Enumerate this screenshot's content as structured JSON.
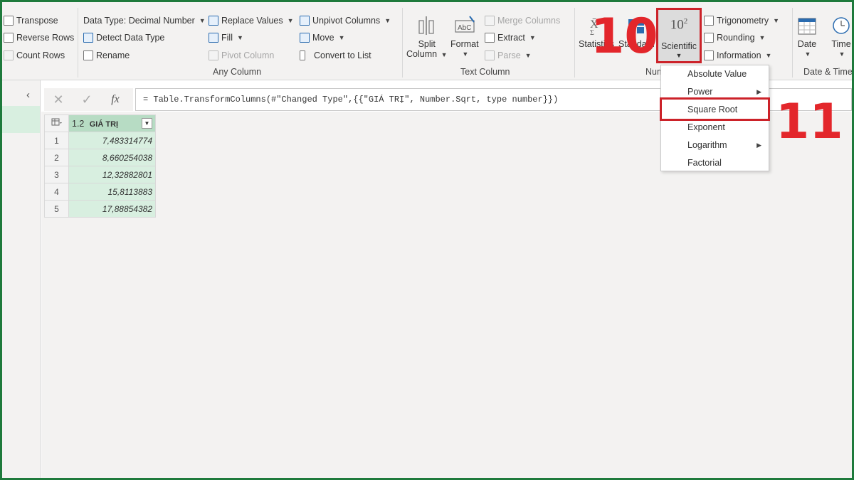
{
  "ribbon": {
    "table_group": {
      "transpose": "Transpose",
      "reverse_rows": "Reverse Rows",
      "count_rows": "Count Rows"
    },
    "any_column": {
      "data_type": "Data Type: Decimal Number",
      "detect_data_type": "Detect Data Type",
      "rename": "Rename",
      "replace_values": "Replace Values",
      "fill": "Fill",
      "pivot_column": "Pivot Column",
      "unpivot_columns": "Unpivot Columns",
      "move": "Move",
      "convert_to_list": "Convert to List",
      "label": "Any Column"
    },
    "text_column": {
      "split_column_l1": "Split",
      "split_column_l2": "Column",
      "format": "Format",
      "merge_columns": "Merge Columns",
      "extract": "Extract",
      "parse": "Parse",
      "label": "Text Column"
    },
    "number_column": {
      "statistics": "Statistics",
      "standard": "Standard",
      "scientific": "Scientific",
      "scientific_base": "10",
      "scientific_exp": "2",
      "trigonometry": "Trigonometry",
      "rounding": "Rounding",
      "information": "Information",
      "label": "Number Column"
    },
    "date_time": {
      "date": "Date",
      "time": "Time",
      "label": "Date & Time Column"
    }
  },
  "annotations": {
    "step10": "10",
    "step11": "11"
  },
  "dropdown": {
    "items": [
      {
        "label": "Absolute Value",
        "submenu": false
      },
      {
        "label": "Power",
        "submenu": true
      },
      {
        "label": "Square Root",
        "submenu": false
      },
      {
        "label": "Exponent",
        "submenu": false
      },
      {
        "label": "Logarithm",
        "submenu": true
      },
      {
        "label": "Factorial",
        "submenu": false
      }
    ]
  },
  "formula_bar": {
    "formula": "= Table.TransformColumns(#\"Changed Type\",{{\"GIÁ TRỊ\", Number.Sqrt, type number}})"
  },
  "grid": {
    "column": {
      "type": "1.2",
      "name": "GIÁ TRỊ"
    },
    "rows": [
      {
        "num": "1",
        "value": "7,483314774"
      },
      {
        "num": "2",
        "value": "8,660254038"
      },
      {
        "num": "3",
        "value": "12,32882801"
      },
      {
        "num": "4",
        "value": "15,8113883"
      },
      {
        "num": "5",
        "value": "17,88854382"
      }
    ]
  },
  "colors": {
    "accent_red": "#cc2229",
    "column_green": "#b7dcc4",
    "frame_green": "#1e7a3c"
  }
}
